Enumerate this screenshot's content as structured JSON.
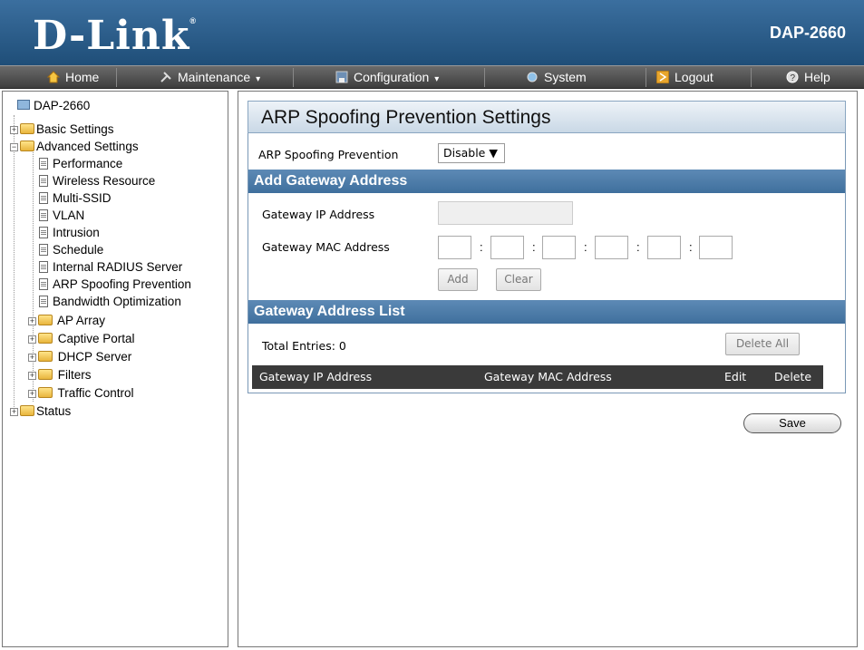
{
  "header": {
    "logo_text": "D-Link",
    "logo_reg": "®",
    "model": "DAP-2660"
  },
  "menu": {
    "home": "Home",
    "maintenance": "Maintenance",
    "configuration": "Configuration",
    "system": "System",
    "logout": "Logout",
    "help": "Help",
    "caret": "▾"
  },
  "sidebar": {
    "root": "DAP-2660",
    "basic_settings": "Basic Settings",
    "advanced_settings": "Advanced Settings",
    "performance": "Performance",
    "wireless_resource": "Wireless Resource",
    "multi_ssid": "Multi-SSID",
    "vlan": "VLAN",
    "intrusion": "Intrusion",
    "schedule": "Schedule",
    "internal_radius": "Internal RADIUS Server",
    "arp_spoofing": "ARP Spoofing Prevention",
    "bandwidth_opt": "Bandwidth Optimization",
    "ap_array": "AP Array",
    "captive_portal": "Captive Portal",
    "dhcp_server": "DHCP Server",
    "filters": "Filters",
    "traffic_control": "Traffic Control",
    "status": "Status",
    "plus": "+",
    "minus": "−"
  },
  "main": {
    "title": "ARP Spoofing Prevention Settings",
    "arp_label": "ARP Spoofing Prevention",
    "arp_value": "Disable ▼",
    "add_gateway_header": "Add Gateway Address",
    "gw_ip_label": "Gateway IP Address",
    "gw_mac_label": "Gateway MAC Address",
    "colon": ":",
    "add_btn": "Add",
    "clear_btn": "Clear",
    "list_header": "Gateway Address List",
    "total_entries": "Total Entries: 0",
    "delete_all_btn": "Delete All",
    "col_ip": "Gateway IP Address",
    "col_mac": "Gateway MAC Address",
    "col_edit": "Edit",
    "col_delete": "Delete",
    "save_btn": "Save"
  }
}
